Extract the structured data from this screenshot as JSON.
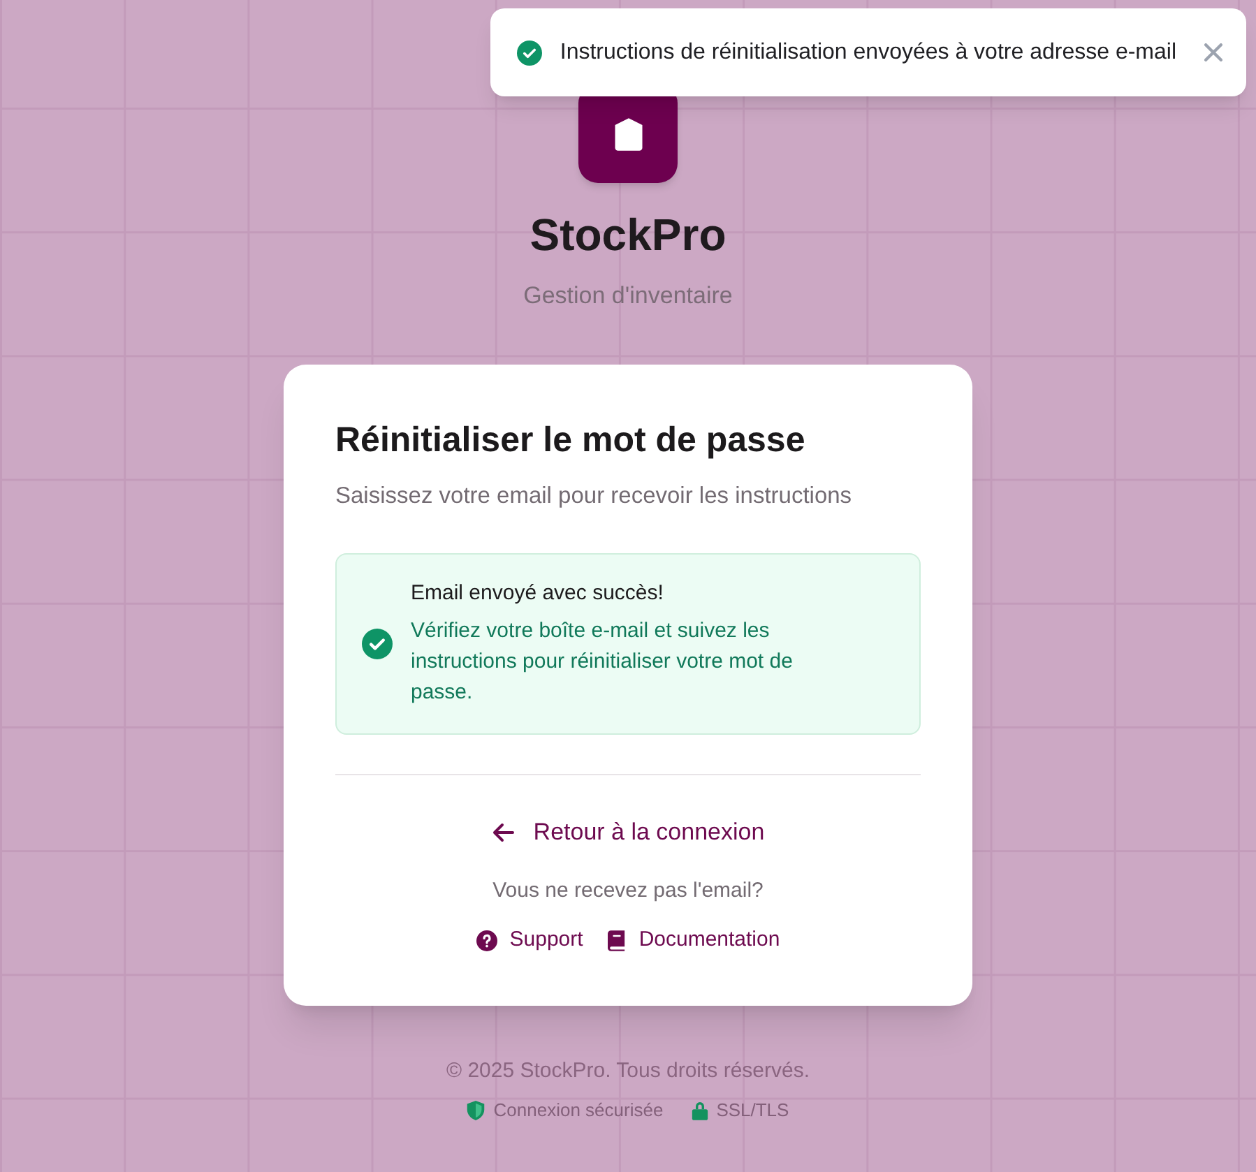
{
  "toast": {
    "kind": "success",
    "message": "Instructions de réinitialisation envoyées à votre adresse e-mail"
  },
  "brand": {
    "name": "StockPro",
    "tagline": "Gestion d'inventaire"
  },
  "card": {
    "title": "Réinitialiser le mot de passe",
    "subtitle": "Saisissez votre email pour recevoir les instructions",
    "alert": {
      "kind": "success",
      "title": "Email envoyé avec succès!",
      "message": "Vérifiez votre boîte e-mail et suivez les instructions pour réinitialiser votre mot de passe."
    },
    "back_link": "Retour à la connexion",
    "help_prompt": "Vous ne recevez pas l'email?",
    "help_links": [
      {
        "kind": "support",
        "label": "Support"
      },
      {
        "kind": "documentation",
        "label": "Documentation"
      }
    ]
  },
  "footer": {
    "copyright": "© 2025 StockPro. Tous droits réservés.",
    "badges": [
      {
        "kind": "shield",
        "label": "Connexion sécurisée"
      },
      {
        "kind": "lock",
        "label": "SSL/TLS"
      }
    ]
  }
}
